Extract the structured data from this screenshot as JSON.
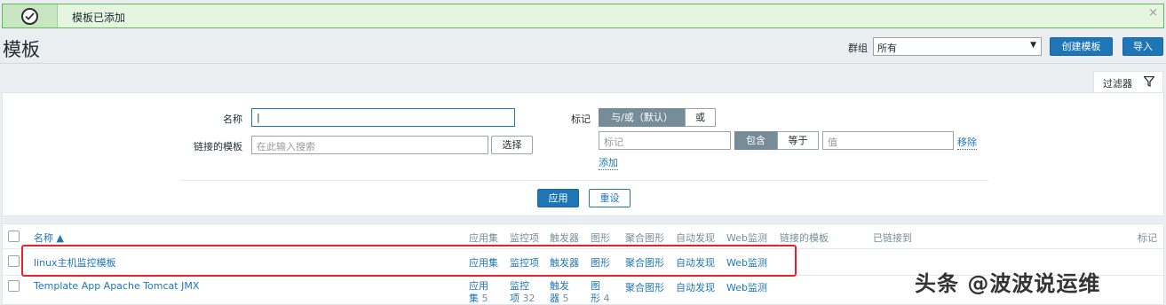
{
  "message": {
    "text": "模板已添加",
    "close": "×"
  },
  "header": {
    "title": "模板",
    "group_label": "群组",
    "group_value": "所有",
    "create_button": "创建模板",
    "import_button": "导入"
  },
  "filter": {
    "tab_label": "过滤器",
    "name_label": "名称",
    "name_value": "",
    "linked_label": "链接的模板",
    "linked_placeholder": "在此输入搜索",
    "select_button": "选择",
    "tag_label": "标记",
    "tag_mode_and": "与/或（默认）",
    "tag_mode_or": "或",
    "tag_placeholder": "标记",
    "op_contains": "包含",
    "op_equals": "等于",
    "value_placeholder": "值",
    "remove_link": "移除",
    "add_link": "添加",
    "apply_button": "应用",
    "reset_button": "重设"
  },
  "table": {
    "columns": [
      "名称 ▲",
      "应用集",
      "监控项",
      "触发器",
      "图形",
      "聚合图形",
      "自动发现",
      "Web监测",
      "链接的模板",
      "已链接到",
      "标记"
    ],
    "rows": [
      {
        "name": "linux主机监控模板",
        "apps": "应用集",
        "items": "监控项",
        "triggers": "触发器",
        "graphs": "图形",
        "screens": "聚合图形",
        "discovery": "自动发现",
        "web": "Web监测"
      },
      {
        "name": "Template App Apache Tomcat JMX",
        "apps_a": "应用",
        "apps_b": "集",
        "apps_count": "5",
        "items_a": "监控",
        "items_b": "项",
        "items_count": "32",
        "triggers_a": "触发",
        "triggers_b": "器",
        "triggers_count": "5",
        "graphs_a": "图",
        "graphs_b": "形",
        "graphs_count": "4",
        "screens": "聚合图形",
        "discovery": "自动发现",
        "web": "Web监测"
      }
    ]
  },
  "watermark": "头条 @波波说运维",
  "colors": {
    "accent": "#1f76b7",
    "success_bg": "#e5f5e0",
    "highlight": "#e8222a"
  }
}
